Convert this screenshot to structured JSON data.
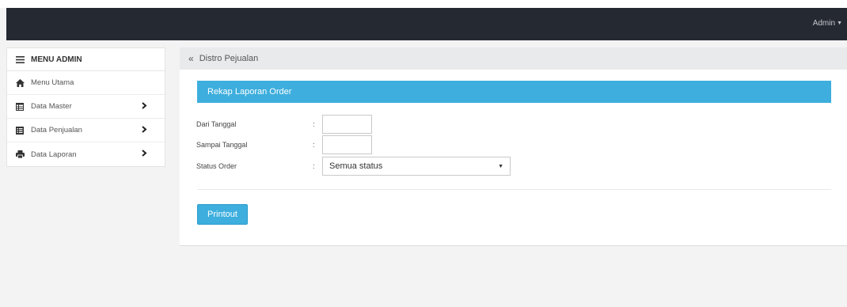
{
  "navbar": {
    "user_label": "Admin"
  },
  "sidebar": {
    "header": "MENU ADMIN",
    "items": [
      {
        "label": "Menu Utama",
        "icon": "home-icon",
        "has_submenu": false
      },
      {
        "label": "Data Master",
        "icon": "table-icon",
        "has_submenu": true
      },
      {
        "label": "Data Penjualan",
        "icon": "list-alt-icon",
        "has_submenu": true
      },
      {
        "label": "Data Laporan",
        "icon": "print-icon",
        "has_submenu": true
      }
    ]
  },
  "breadcrumb": {
    "title": "Distro Pejualan"
  },
  "panel": {
    "title": "Rekap Laporan Order",
    "fields": {
      "from_date": {
        "label": "Dari Tanggal",
        "value": ""
      },
      "to_date": {
        "label": "Sampai Tanggal",
        "value": ""
      },
      "status": {
        "label": "Status Order",
        "selected": "Semua status"
      }
    },
    "colon": ":",
    "print_button": "Printout"
  },
  "colors": {
    "navbar": "#252932",
    "accent": "#3daedd",
    "background": "#f3f3f4"
  }
}
